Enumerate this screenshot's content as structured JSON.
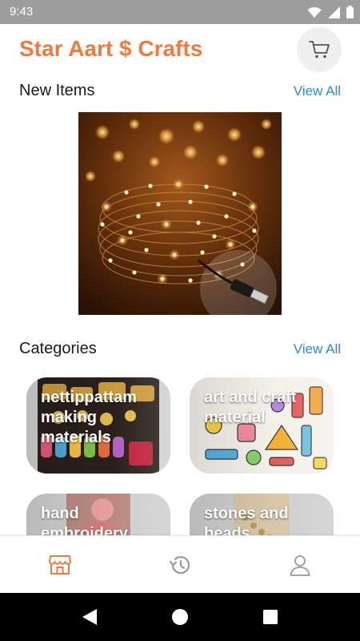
{
  "status_bar": {
    "time": "9:43"
  },
  "header": {
    "title": "Star Aart $ Crafts",
    "cart_icon": "cart-icon"
  },
  "new_items": {
    "title": "New Items",
    "view_all": "View All"
  },
  "categories": {
    "title": "Categories",
    "view_all": "View All",
    "items": [
      {
        "label": "nettippattam making materials"
      },
      {
        "label": "art and craft material"
      },
      {
        "label": "hand embroidery"
      },
      {
        "label": "stones and beads"
      }
    ]
  },
  "bottom_nav": {
    "items": [
      {
        "icon": "store-icon",
        "active": true
      },
      {
        "icon": "history-icon",
        "active": false
      },
      {
        "icon": "profile-icon",
        "active": false
      }
    ]
  },
  "colors": {
    "brand": "#f27a3c",
    "link": "#2a8ad4",
    "status_bar": "#9e9e9e",
    "inactive_icon": "#9a9a9a"
  }
}
